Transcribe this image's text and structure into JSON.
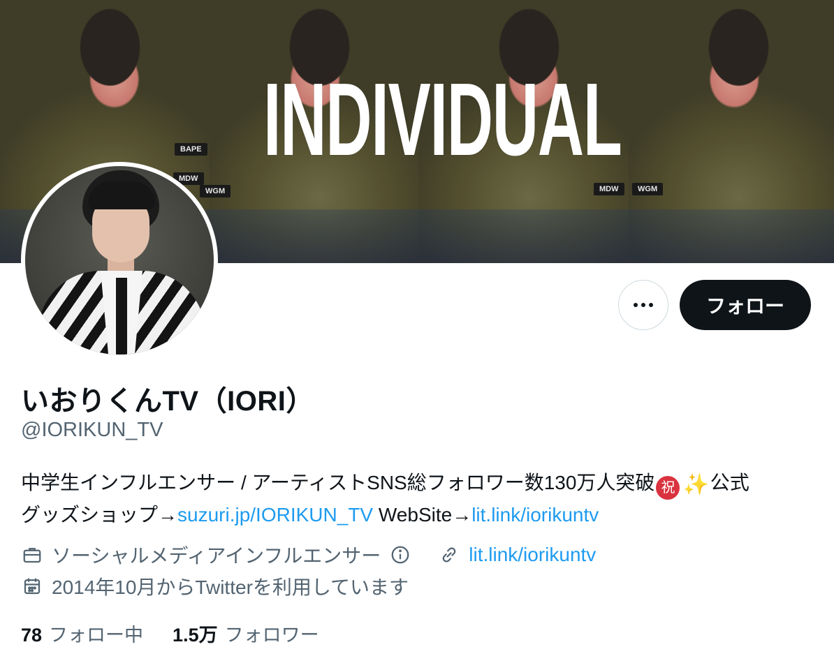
{
  "banner": {
    "title": "INDIVIDUAL",
    "tags": [
      "MDW",
      "WGM",
      "BAPE",
      "MDW",
      "WGM"
    ]
  },
  "profile": {
    "display_name": "いおりくんTV（IORI）",
    "handle": "@IORIKUN_TV",
    "bio": {
      "line1_text": "中学生インフルエンサー / アーティストSNS総フォロワー数130万人突破",
      "emoji_iwai": "祝",
      "emoji_sparkles": "✨",
      "line1_tail": "公式",
      "line2_prefix": "グッズショップ→",
      "shop_link": "suzuri.jp/IORIKUN_TV",
      "website_label": " WebSite→",
      "website_link": "lit.link/iorikuntv"
    },
    "category": "ソーシャルメディアインフルエンサー",
    "url": "lit.link/iorikuntv",
    "joined": "2014年10月からTwitterを利用しています"
  },
  "actions": {
    "follow_label": "フォロー"
  },
  "stats": {
    "following_count": "78",
    "following_label": "フォロー中",
    "followers_count": "1.5万",
    "followers_label": "フォロワー"
  },
  "colors": {
    "text_primary": "#0f1419",
    "text_secondary": "#536471",
    "link": "#1d9bf0",
    "follow_button_bg": "#0f1419"
  },
  "icons": {
    "category": "briefcase-icon",
    "info": "info-icon",
    "url": "link-icon",
    "joined": "calendar-icon",
    "more": "more-dots-icon"
  }
}
